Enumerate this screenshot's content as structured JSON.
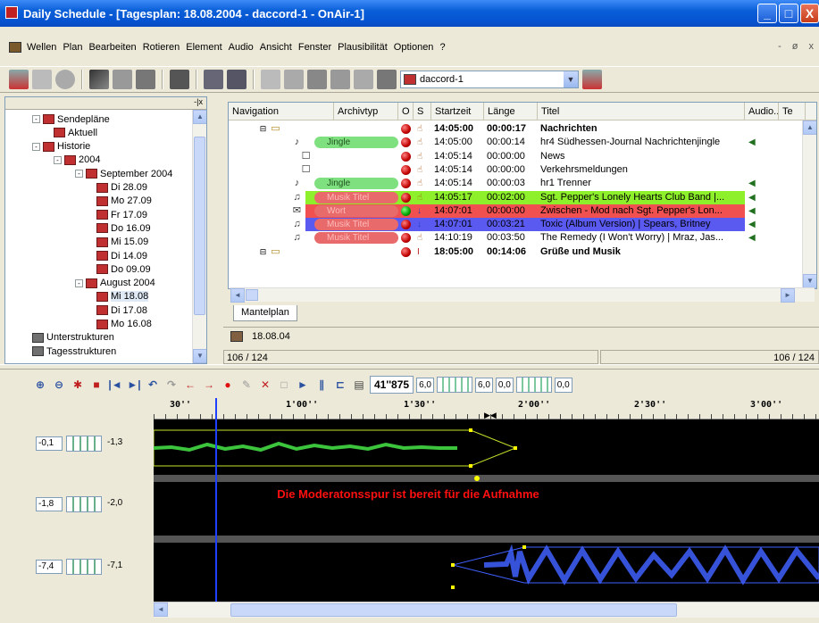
{
  "window": {
    "title": "Daily Schedule - [Tagesplan: 18.08.2004 - daccord-1 - OnAir-1]",
    "btn_min": "_",
    "btn_max": "□",
    "btn_close": "X"
  },
  "menu": {
    "items": [
      "Wellen",
      "Plan",
      "Bearbeiten",
      "Rotieren",
      "Element",
      "Audio",
      "Ansicht",
      "Fenster",
      "Plausibilität",
      "Optionen",
      "?"
    ],
    "mdi_min": "-",
    "mdi_restore": "ø",
    "mdi_close": "x"
  },
  "toolbar": {
    "station_combo_value": "daccord-1"
  },
  "tree": {
    "header_close": "-|x",
    "nodes": [
      {
        "label": "Sendepläne",
        "exp": "-"
      },
      {
        "label": "Aktuell",
        "exp": ""
      },
      {
        "label": "Historie",
        "exp": "-"
      },
      {
        "label": "2004",
        "exp": "-"
      },
      {
        "label": "September 2004",
        "exp": "-"
      },
      {
        "label": "Di 28.09",
        "exp": ""
      },
      {
        "label": "Mo 27.09",
        "exp": ""
      },
      {
        "label": "Fr 17.09",
        "exp": ""
      },
      {
        "label": "Do 16.09",
        "exp": ""
      },
      {
        "label": "Mi 15.09",
        "exp": ""
      },
      {
        "label": "Di 14.09",
        "exp": ""
      },
      {
        "label": "Do 09.09",
        "exp": ""
      },
      {
        "label": "August 2004",
        "exp": "-"
      },
      {
        "label": "Mi 18.08",
        "exp": ""
      },
      {
        "label": "Di 17.08",
        "exp": ""
      },
      {
        "label": "Mo 16.08",
        "exp": ""
      },
      {
        "label": "Unterstrukturen",
        "exp": ""
      },
      {
        "label": "Tagesstrukturen",
        "exp": ""
      }
    ]
  },
  "grid": {
    "columns": [
      "Navigation",
      "Archivtyp",
      "O",
      "S",
      "Startzeit",
      "Länge",
      "Titel",
      "Audio...",
      "Te"
    ],
    "rows": [
      {
        "archivtyp": "",
        "start": "14:05:00",
        "length": "00:00:17",
        "title": "Nachrichten",
        "bold": true,
        "kind": "folder",
        "pill": "",
        "audio": false,
        "sicon": "hand",
        "dot": "red"
      },
      {
        "archivtyp": "Jingle",
        "start": "14:05:00",
        "length": "00:00:14",
        "title": "hr4 Südhessen-Journal Nachrichtenjingle",
        "bold": false,
        "kind": "jingle",
        "pill": "#7ee07e",
        "audio": true,
        "sicon": "hand",
        "dot": "red"
      },
      {
        "archivtyp": "",
        "start": "14:05:14",
        "length": "00:00:00",
        "title": "News",
        "bold": false,
        "kind": "doc",
        "pill": "",
        "audio": false,
        "sicon": "hand",
        "dot": "red"
      },
      {
        "archivtyp": "",
        "start": "14:05:14",
        "length": "00:00:00",
        "title": "Verkehrsmeldungen",
        "bold": false,
        "kind": "doc",
        "pill": "",
        "audio": false,
        "sicon": "hand",
        "dot": "red"
      },
      {
        "archivtyp": "Jingle",
        "start": "14:05:14",
        "length": "00:00:03",
        "title": "hr1 Trenner",
        "bold": false,
        "kind": "jingle",
        "pill": "#7ee07e",
        "audio": true,
        "sicon": "hand",
        "dot": "red"
      },
      {
        "archivtyp": "Musik Titel",
        "start": "14:05:17",
        "length": "00:02:00",
        "title": "Sgt. Pepper's Lonely Hearts Club Band |...",
        "bold": false,
        "kind": "music",
        "pill": "#e86a6a",
        "audio": true,
        "sicon": "hand",
        "dot": "red",
        "rowbg": "#8ef02a"
      },
      {
        "archivtyp": "Wort",
        "start": "14:07:01",
        "length": "00:00:00",
        "title": "Zwischen - Mod nach Sgt. Pepper's Lon...",
        "bold": false,
        "kind": "mic",
        "pill": "#e86a6a",
        "audio": true,
        "sicon": "arrow",
        "dot": "green",
        "rowbg": "#f05050"
      },
      {
        "archivtyp": "Musik Titel",
        "start": "14:07:01",
        "length": "00:03:21",
        "title": "Toxic (Album Version) | Spears, Britney",
        "bold": false,
        "kind": "music",
        "pill": "#e86a6a",
        "audio": true,
        "sicon": "arrow",
        "dot": "red",
        "rowbg": "#5a5af0"
      },
      {
        "archivtyp": "Musik Titel",
        "start": "14:10:19",
        "length": "00:03:50",
        "title": "The Remedy (I Won't Worry) | Mraz, Jas...",
        "bold": false,
        "kind": "music",
        "pill": "#e86a6a",
        "audio": true,
        "sicon": "hand",
        "dot": "red"
      },
      {
        "archivtyp": "",
        "start": "18:05:00",
        "length": "00:14:06",
        "title": "Grüße und Musik",
        "bold": true,
        "kind": "folder",
        "pill": "",
        "audio": false,
        "sicon": "cursor",
        "dot": "red"
      }
    ],
    "status_left": "106 / 124",
    "status_right": "106 / 124"
  },
  "tabs": {
    "mantelplan": "Mantelplan"
  },
  "datebar": {
    "date": "18.08.04"
  },
  "editor": {
    "time_display": "41''875",
    "val1": "6,0",
    "val2": "6,0",
    "val3": "0,0",
    "val4": "0,0",
    "ruler_labels": [
      "30''",
      "1'00''",
      "1'30''",
      "2'00''",
      "2'30''",
      "3'00''"
    ],
    "tracks": [
      {
        "left": "-0,1",
        "right": "-1,3"
      },
      {
        "left": "-1,8",
        "right": "-2,0"
      },
      {
        "left": "-7,4",
        "right": "-7,1"
      }
    ],
    "message": "Die Moderatonsspur ist bereit für die Aufnahme"
  },
  "colors": {
    "accent": "#0a5fd8",
    "playhead": "#2040ff",
    "message": "#ff1010",
    "wave_green": "#3cc43c",
    "wave_blue": "#4060ff"
  }
}
